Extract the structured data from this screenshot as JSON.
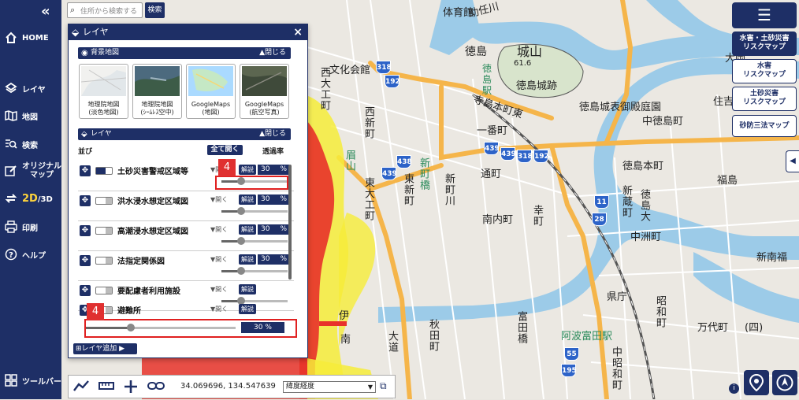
{
  "sidebar": {
    "collapse": "«",
    "items": [
      {
        "label": "HOME",
        "icon": "home-icon"
      },
      {
        "label": "レイヤ",
        "icon": "layers-icon"
      },
      {
        "label": "地図",
        "icon": "map-icon"
      },
      {
        "label": "検索",
        "icon": "search-list-icon"
      },
      {
        "label": "オリジナル\nマップ",
        "icon": "edit-icon"
      },
      {
        "label_strong": "2D",
        "label_rest": "/3D",
        "icon": "swap-icon"
      },
      {
        "label": "印刷",
        "icon": "print-icon"
      },
      {
        "label": "ヘルプ",
        "icon": "help-icon"
      },
      {
        "label": "ツールバー",
        "icon": "grid-icon"
      }
    ]
  },
  "search": {
    "placeholder": "住所から検索する",
    "button": "検索"
  },
  "right_panel": {
    "menu": "☰",
    "buttons": [
      "水害・土砂災害\nリスクマップ",
      "水害\nリスクマップ",
      "土砂災害\nリスクマップ",
      "砂防三法マップ"
    ],
    "collapse_tab": "◀"
  },
  "layer_panel": {
    "title": "レイヤ",
    "close": "×",
    "basemap_section": {
      "title": "背景地図",
      "close": "▲閉じる"
    },
    "basemaps": [
      {
        "label": "地理院地図\n(淡色地図)"
      },
      {
        "label": "地理院地図\n(ｼｰﾑﾚｽ空中)"
      },
      {
        "label": "GoogleMaps\n(地図)"
      },
      {
        "label": "GoogleMaps\n(航空写真)"
      }
    ],
    "layer_section": {
      "title": "レイヤ",
      "close": "▲閉じる"
    },
    "col_order": "並び",
    "open_all": "全て開く",
    "col_opacity": "透過率",
    "layers": [
      {
        "name": "土砂災害警戒区域等",
        "expand": "▼開く",
        "kaisetsu": "解説",
        "opacity": "30",
        "unit": "%",
        "enabled": true,
        "slider": 0.3
      },
      {
        "name": "洪水浸水想定区域図",
        "expand": "▼開く",
        "kaisetsu": "解説",
        "opacity": "30",
        "unit": "%",
        "enabled": false,
        "slider": 0.3
      },
      {
        "name": "高潮浸水想定区域図",
        "expand": "▼開く",
        "kaisetsu": "解説",
        "opacity": "30",
        "unit": "%",
        "enabled": false,
        "slider": 0.3
      },
      {
        "name": "法指定関係図",
        "expand": "▼開く",
        "kaisetsu": "解説",
        "opacity": "30",
        "unit": "%",
        "enabled": false,
        "slider": 0.3
      },
      {
        "name": "要配慮者利用施設",
        "expand": "▼開く",
        "kaisetsu": "解説",
        "enabled": false,
        "slider": 0.3
      },
      {
        "name": "避難所",
        "expand": "▼開く",
        "kaisetsu": "解説",
        "enabled": false
      }
    ],
    "shelter_opacity": {
      "value": "30",
      "unit": "%",
      "slider": 0.3
    },
    "add_layer": "レイヤ追加 ▶",
    "annotation_badge": "4"
  },
  "toolbar": {
    "coords": "34.069696, 134.547639",
    "format": "緯度経度",
    "icons": [
      "polyline-icon",
      "ruler-icon",
      "crosshair-icon",
      "link-icon",
      "copy-icon"
    ]
  },
  "map": {
    "labels": [
      {
        "t": "体育館"
      },
      {
        "t": "徳島"
      },
      {
        "t": "城山"
      },
      {
        "t": "61.6"
      },
      {
        "t": "徳島城跡"
      },
      {
        "t": "文化会館"
      },
      {
        "t": "徳島駅"
      },
      {
        "t": "寺島本町東"
      },
      {
        "t": "一番町"
      },
      {
        "t": "徳島城表御殿庭園"
      },
      {
        "t": "中徳島町"
      },
      {
        "t": "西新町"
      },
      {
        "t": "西大工町"
      },
      {
        "t": "徳島本町"
      },
      {
        "t": "通町"
      },
      {
        "t": "新蔵町"
      },
      {
        "t": "徳島大"
      },
      {
        "t": "福島"
      },
      {
        "t": "眉山"
      },
      {
        "t": "新町橋"
      },
      {
        "t": "東新町"
      },
      {
        "t": "新町川"
      },
      {
        "t": "南内町"
      },
      {
        "t": "幸町"
      },
      {
        "t": "中洲町"
      },
      {
        "t": "新南福"
      },
      {
        "t": "県庁"
      },
      {
        "t": "万代町"
      },
      {
        "t": "(四)"
      },
      {
        "t": "秋田町"
      },
      {
        "t": "富田橋"
      },
      {
        "t": "阿波富田駅"
      },
      {
        "t": "昭和町"
      },
      {
        "t": "中昭和町"
      },
      {
        "t": "大道"
      },
      {
        "t": "住吉"
      },
      {
        "t": "大岡"
      },
      {
        "t": "助任川"
      },
      {
        "t": "伊"
      },
      {
        "t": "南"
      },
      {
        "t": "東大工町"
      }
    ],
    "shields": [
      "318",
      "192",
      "439",
      "439",
      "318",
      "192",
      "439",
      "438",
      "11",
      "28",
      "55",
      "195"
    ],
    "colors": {
      "water": "#9ccbe8",
      "road_major": "#f5b54a",
      "road_minor": "#ffffff",
      "block": "#e9e6e0",
      "hazard_red": "#e8322a",
      "hazard_yellow": "#f6ec3a",
      "rail": "#555555"
    }
  },
  "colors": {
    "brand": "#1e2f66",
    "highlight": "#e02020"
  }
}
